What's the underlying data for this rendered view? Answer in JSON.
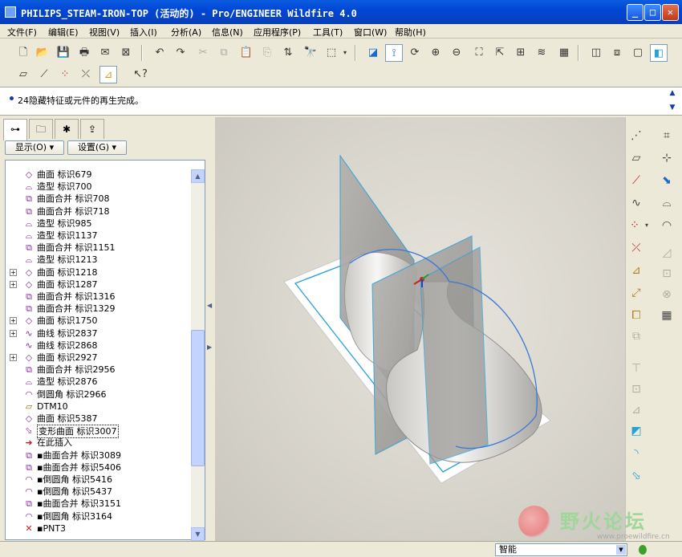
{
  "window": {
    "title": "PHILIPS_STEAM-IRON-TOP (活动的) - Pro/ENGINEER Wildfire 4.0",
    "minimize": "_",
    "maximize": "□",
    "close": "✕"
  },
  "menu": [
    "文件(F)",
    "编辑(E)",
    "视图(V)",
    "插入(I)",
    "分析(A)",
    "信息(N)",
    "应用程序(P)",
    "工具(T)",
    "窗口(W)",
    "帮助(H)"
  ],
  "message": {
    "text": "24隐藏特征或元件的再生完成。"
  },
  "nav": {
    "show_label": "显示(O) ▾",
    "settings_label": "设置(G) ▾"
  },
  "tree": [
    {
      "icon": "surface-icon",
      "label": "曲面  标识679",
      "expand": false
    },
    {
      "icon": "style-icon",
      "label": "造型  标识700",
      "expand": false
    },
    {
      "icon": "merge-icon",
      "label": "曲面合并  标识708",
      "expand": false
    },
    {
      "icon": "merge-icon",
      "label": "曲面合并  标识718",
      "expand": false
    },
    {
      "icon": "style-icon",
      "label": "造型  标识985",
      "expand": false
    },
    {
      "icon": "style-icon",
      "label": "造型  标识1137",
      "expand": false
    },
    {
      "icon": "merge-icon",
      "label": "曲面合并  标识1151",
      "expand": false
    },
    {
      "icon": "style-icon",
      "label": "造型  标识1213",
      "expand": false
    },
    {
      "icon": "surface-icon",
      "label": "曲面  标识1218",
      "expand": true
    },
    {
      "icon": "surface-icon",
      "label": "曲面  标识1287",
      "expand": true
    },
    {
      "icon": "merge-icon",
      "label": "曲面合并  标识1316",
      "expand": false
    },
    {
      "icon": "merge-icon",
      "label": "曲面合并  标识1329",
      "expand": false
    },
    {
      "icon": "surface-icon",
      "label": "曲面  标识1750",
      "expand": true
    },
    {
      "icon": "curve-icon",
      "label": "曲线  标识2837",
      "expand": true
    },
    {
      "icon": "curve-icon",
      "label": "曲线  标识2868",
      "expand": false
    },
    {
      "icon": "surface-icon",
      "label": "曲面  标识2927",
      "expand": true
    },
    {
      "icon": "merge-icon",
      "label": "曲面合并  标识2956",
      "expand": false
    },
    {
      "icon": "style-icon",
      "label": "造型  标识2876",
      "expand": false
    },
    {
      "icon": "round-icon",
      "label": "倒圆角  标识2966",
      "expand": false
    },
    {
      "icon": "datum-plane-icon",
      "label": "DTM10",
      "expand": false
    },
    {
      "icon": "surface-icon",
      "label": "曲面  标识5387",
      "expand": false
    },
    {
      "icon": "warp-icon",
      "label": "变形曲面  标识3007",
      "expand": false,
      "selected": true
    },
    {
      "icon": "insert-here-icon",
      "label": "在此插入",
      "expand": false
    },
    {
      "icon": "merge-icon",
      "label": "▪曲面合并  标识3089",
      "expand": false
    },
    {
      "icon": "merge-icon",
      "label": "▪曲面合并  标识5406",
      "expand": false
    },
    {
      "icon": "round-icon",
      "label": "▪倒圆角  标识5416",
      "expand": false
    },
    {
      "icon": "round-icon",
      "label": "▪倒圆角  标识5437",
      "expand": false
    },
    {
      "icon": "merge-icon",
      "label": "▪曲面合并  标识3151",
      "expand": false
    },
    {
      "icon": "round-icon",
      "label": "▪倒圆角  标识3164",
      "expand": false
    },
    {
      "icon": "point-icon",
      "label": "▪PNT3",
      "expand": false
    }
  ],
  "status": {
    "filter": "智能"
  },
  "watermark": {
    "text": "野火论坛",
    "url": "www.proewildfire.cn"
  },
  "colors": {
    "titlebar": "#0047d6",
    "accent_blue": "#3a78d6",
    "datum_cyan": "#2aa0d8",
    "tree_icon": "#8a2aa0"
  }
}
